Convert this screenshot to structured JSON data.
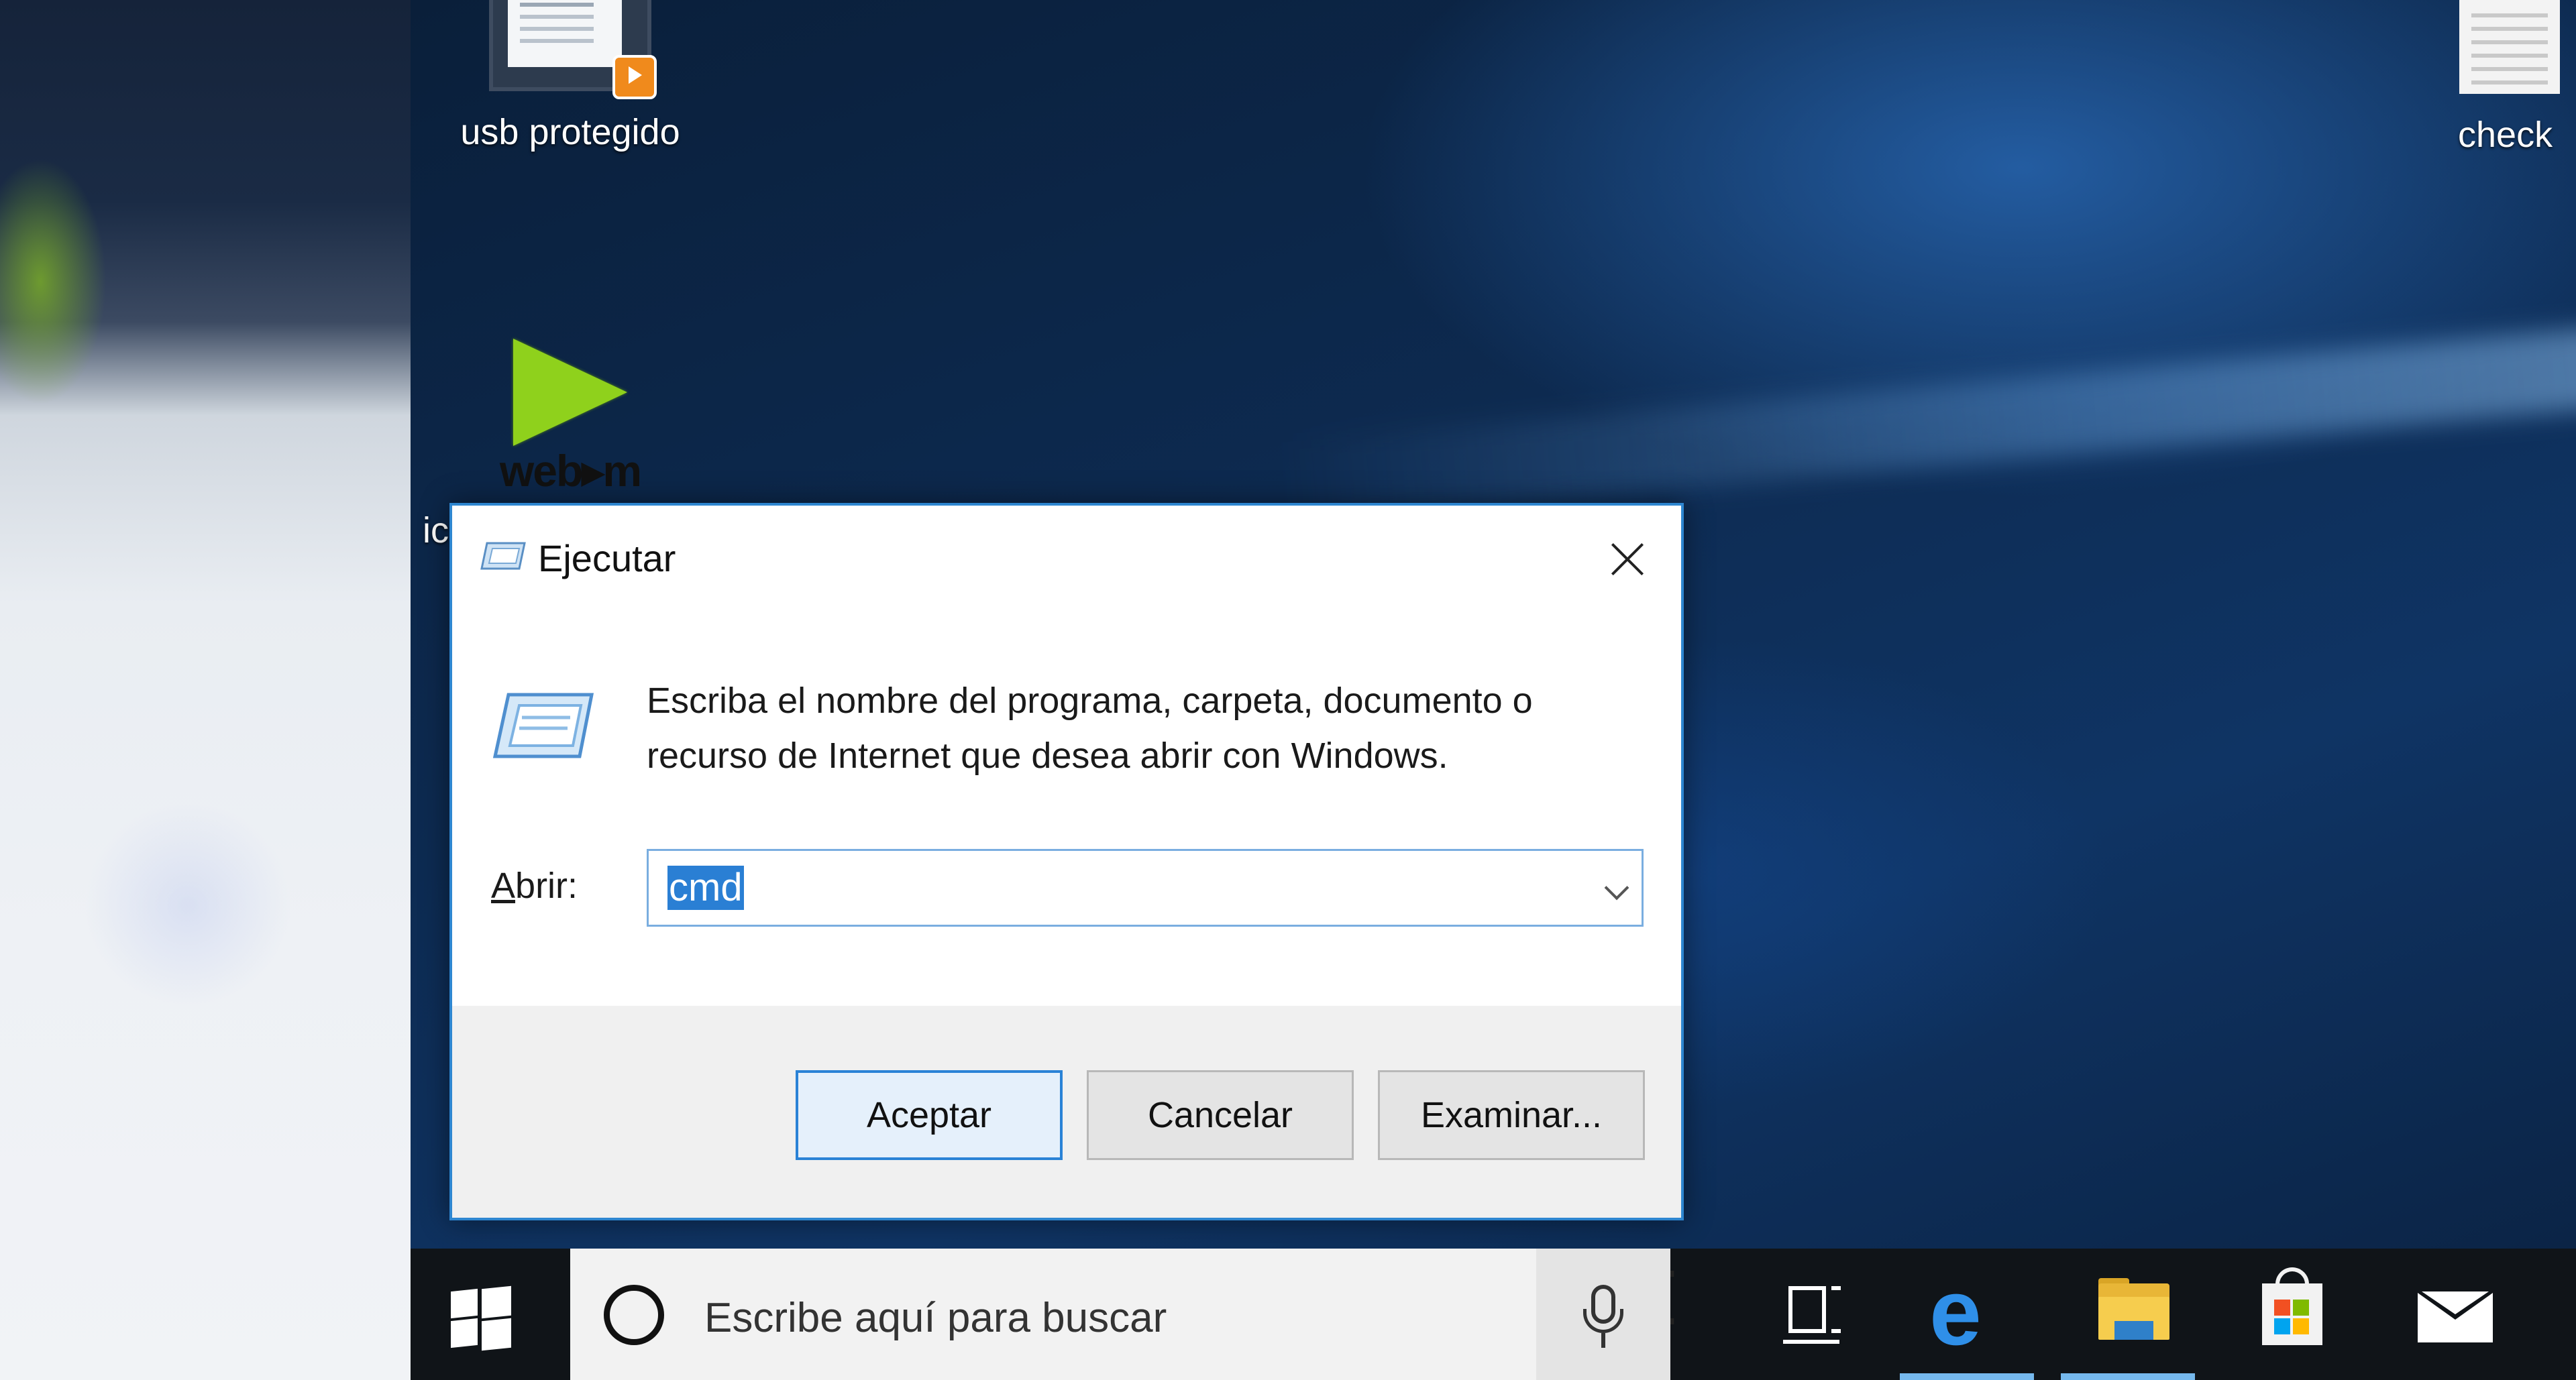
{
  "desktop": {
    "icons": {
      "usb_label": "usb protegido",
      "webm_label": "web▸m",
      "partial_label": "ic",
      "check_label": "check"
    }
  },
  "dialog": {
    "title": "Ejecutar",
    "description": "Escriba el nombre del programa, carpeta, documento o recurso de Internet que desea abrir con Windows.",
    "open_label_accel": "A",
    "open_label_rest": "brir:",
    "open_value": "cmd",
    "buttons": {
      "ok": "Aceptar",
      "cancel": "Cancelar",
      "browse": "Examinar..."
    }
  },
  "taskbar": {
    "search_placeholder": "Escribe aquí para buscar",
    "edge_glyph": "e",
    "cursor_glyph": "I"
  },
  "colors": {
    "accent": "#2e86d0",
    "selection": "#2a7fd4",
    "taskbar": "#101418",
    "webm_green": "#8fd11c"
  }
}
